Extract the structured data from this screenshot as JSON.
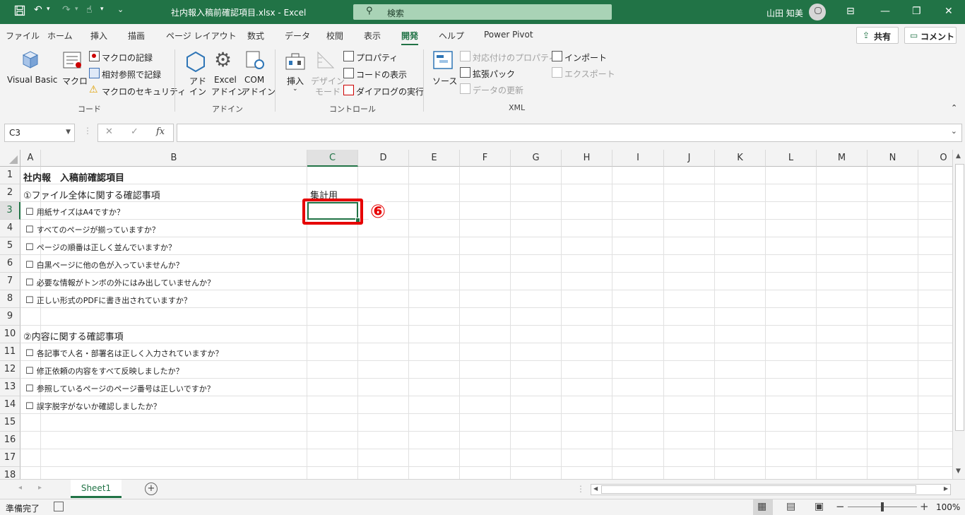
{
  "window": {
    "title": "社内報入稿前確認項目.xlsx  -  Excel",
    "search_placeholder": "検索",
    "user": "山田 知美"
  },
  "menu": {
    "tabs": [
      "ファイル",
      "ホーム",
      "挿入",
      "描画",
      "ページ レイアウト",
      "数式",
      "データ",
      "校閲",
      "表示",
      "開発",
      "ヘルプ",
      "Power Pivot"
    ],
    "active_tab": "開発",
    "share_label": "共有",
    "comment_label": "コメント"
  },
  "ribbon": {
    "code": {
      "group_name": "コード",
      "visual_basic": "Visual Basic",
      "macro": "マクロ",
      "record_macro": "マクロの記録",
      "relative_ref": "相対参照で記録",
      "macro_security": "マクロのセキュリティ"
    },
    "addins": {
      "group_name": "アドイン",
      "addin_line1": "アド",
      "addin_line2": "イン",
      "excel_addin_line1": "Excel",
      "excel_addin_line2": "アドイン",
      "com_addin_line1": "COM",
      "com_addin_line2": "アドイン"
    },
    "controls": {
      "group_name": "コントロール",
      "insert": "挿入",
      "design_mode_line1": "デザイン",
      "design_mode_line2": "モード",
      "properties": "プロパティ",
      "view_code": "コードの表示",
      "run_dialog": "ダイアログの実行"
    },
    "xml": {
      "group_name": "XML",
      "source": "ソース",
      "map_properties": "対応付けのプロパティ",
      "expansion_packs": "拡張パック",
      "refresh_data": "データの更新",
      "import": "インポート",
      "export": "エクスポート"
    }
  },
  "formula_bar": {
    "name_box": "C3",
    "fx_label": "fx",
    "formula": ""
  },
  "grid": {
    "columns": [
      "A",
      "B",
      "C",
      "D",
      "E",
      "F",
      "G",
      "H",
      "I",
      "J",
      "K",
      "L",
      "M",
      "N",
      "O"
    ],
    "rows": [
      "1",
      "2",
      "3",
      "4",
      "5",
      "6",
      "7",
      "8",
      "9",
      "10",
      "11",
      "12",
      "13",
      "14",
      "15",
      "16",
      "17",
      "18"
    ],
    "selected_cell": "C3",
    "title": "社内報　入稿前確認項目",
    "section1": "①ファイル全体に関する確認事項",
    "tally_header": "集計用",
    "section1_items": [
      "用紙サイズはA4ですか？",
      "すべてのページが揃っていますか？",
      "ページの順番は正しく並んでいますか？",
      "白黒ページに他の色が入っていませんか？",
      "必要な情報がトンボの外にはみ出していませんか？",
      "正しい形式のPDFに書き出されていますか？"
    ],
    "section2": "②内容に関する確認事項",
    "section2_items": [
      "各記事で人名・部署名は正しく入力されていますか？",
      "修正依頼の内容をすべて反映しましたか？",
      "参照しているページのページ番号は正しいですか？",
      "誤字脱字がないか確認しましたか？"
    ],
    "checkbox_glyph": "☐",
    "annotation": "⑥"
  },
  "sheets": {
    "tabs": [
      "Sheet1"
    ]
  },
  "status": {
    "ready": "準備完了",
    "zoom": "100%"
  },
  "colors": {
    "excel_green": "#217346",
    "annotation_red": "#e60000"
  }
}
